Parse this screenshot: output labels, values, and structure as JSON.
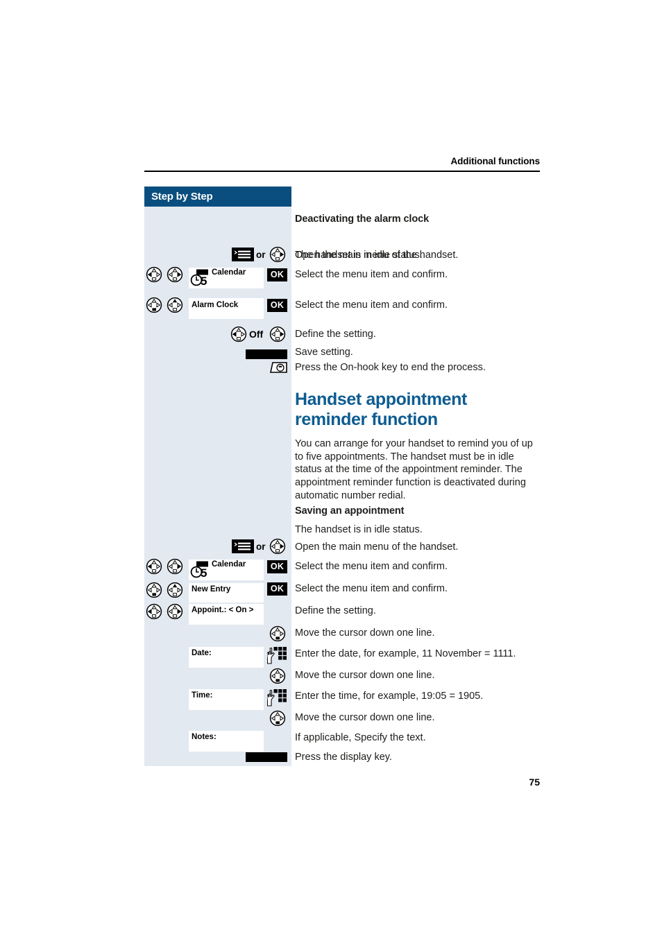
{
  "page": {
    "running_head": "Additional functions",
    "page_number": "75",
    "accent_blue": "#0d5c92",
    "sidebar_header_blue": "#0a4e7f",
    "sidebar_bg": "#e3e9f0"
  },
  "sidebar": {
    "title": "Step by Step"
  },
  "sections": [
    {
      "heading": "Deactivating the alarm clock",
      "steps": [
        {
          "id": "idle-1",
          "text": "The handset is in idle status.",
          "icons": [],
          "field": null
        },
        {
          "id": "open-menu-1",
          "text": "Open the main menu of the handset.",
          "icons": [
            "menu-key-icon",
            "or-label",
            "nav-key-right-icon"
          ],
          "field": null
        },
        {
          "id": "select-calendar-1",
          "text": "Select the menu item and confirm.",
          "icons": [
            "nav-key-left-icon",
            "nav-key-right-icon"
          ],
          "field": {
            "type": "calendar",
            "label": "Calendar"
          },
          "confirm_key": "OK"
        },
        {
          "id": "select-alarm-clock",
          "text": "Select the menu item and confirm.",
          "icons": [
            "nav-key-down-icon",
            "nav-key-up-icon"
          ],
          "field": {
            "type": "text",
            "label": "Alarm Clock"
          },
          "confirm_key": "OK"
        },
        {
          "id": "define-setting-off",
          "text": "Define the setting.",
          "icons": [
            "nav-key-left-icon",
            "off-label",
            "nav-key-right-icon"
          ],
          "field": null,
          "value_label": "Off"
        },
        {
          "id": "save-setting",
          "text": "Save setting.",
          "icons": [
            "display-key-icon"
          ],
          "field": null
        },
        {
          "id": "on-hook-1",
          "text": "Press the On-hook key to end the process.",
          "icons": [
            "on-hook-key-icon"
          ],
          "field": null
        }
      ]
    },
    {
      "heading": "Handset appointment reminder function",
      "is_main_heading": true,
      "paragraph": "You can arrange for your handset to remind you of up to five appointments. The handset must be in idle status at the time of the appointment reminder. The appointment reminder function is deactivated during automatic number redial."
    },
    {
      "heading": "Saving an appointment",
      "steps": [
        {
          "id": "idle-2",
          "text": "The handset is in idle status.",
          "icons": [],
          "field": null
        },
        {
          "id": "open-menu-2",
          "text": "Open the main menu of the handset.",
          "icons": [
            "menu-key-icon",
            "or-label",
            "nav-key-right-icon"
          ],
          "field": null
        },
        {
          "id": "select-calendar-2",
          "text": "Select the menu item and confirm.",
          "icons": [
            "nav-key-left-icon",
            "nav-key-right-icon"
          ],
          "field": {
            "type": "calendar",
            "label": "Calendar"
          },
          "confirm_key": "OK"
        },
        {
          "id": "select-new-entry",
          "text": "Select the menu item and confirm.",
          "icons": [
            "nav-key-down-icon",
            "nav-key-up-icon"
          ],
          "field": {
            "type": "text",
            "label": "New Entry"
          },
          "confirm_key": "OK"
        },
        {
          "id": "define-appoint-on",
          "text": "Define the setting.",
          "icons": [
            "nav-key-left-icon",
            "nav-key-right-icon"
          ],
          "field": {
            "type": "text",
            "label": "Appoint.: < On >"
          }
        },
        {
          "id": "cursor-down-1",
          "text": "Move the cursor down one line.",
          "icons": [
            "nav-key-down-icon"
          ],
          "field": null
        },
        {
          "id": "enter-date",
          "text": "Enter the date, for example, 11 November = 1111.",
          "icons": [
            "keypad-icon"
          ],
          "field": {
            "type": "text",
            "label": "Date:"
          }
        },
        {
          "id": "cursor-down-2",
          "text": "Move the cursor down one line.",
          "icons": [
            "nav-key-down-icon"
          ],
          "field": null
        },
        {
          "id": "enter-time",
          "text": "Enter the time, for example, 19:05 = 1905.",
          "icons": [
            "keypad-icon"
          ],
          "field": {
            "type": "text",
            "label": "Time:"
          }
        },
        {
          "id": "cursor-down-3",
          "text": "Move the cursor down one line.",
          "icons": [
            "nav-key-down-icon"
          ],
          "field": null
        },
        {
          "id": "notes",
          "text": "If applicable, Specify the text.",
          "icons": [],
          "field": {
            "type": "text",
            "label": "Notes:"
          }
        },
        {
          "id": "press-display-key",
          "text": "Press the display key.",
          "icons": [
            "display-key-icon"
          ],
          "field": null
        }
      ]
    }
  ],
  "labels": {
    "or": "or",
    "off": "Off",
    "ok": "OK",
    "calendar_day": "5"
  }
}
